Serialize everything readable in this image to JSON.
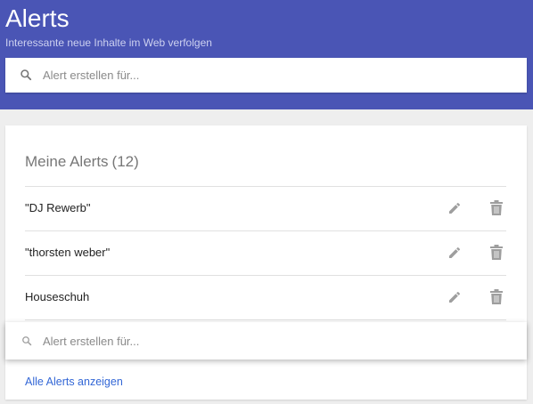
{
  "header": {
    "title": "Alerts",
    "subtitle": "Interessante neue Inhalte im Web verfolgen",
    "background_color": "#4a55b5"
  },
  "search": {
    "placeholder": "Alert erstellen für...",
    "icon": "search-icon"
  },
  "my_alerts": {
    "title": "Meine Alerts",
    "count": "(12)",
    "items": [
      {
        "label": "\"DJ Rewerb\"",
        "actions": [
          "pencil-icon",
          "trash-icon"
        ]
      },
      {
        "label": "\"thorsten weber\"",
        "actions": [
          "pencil-icon",
          "trash-icon"
        ]
      },
      {
        "label": "Houseschuh",
        "actions": [
          "pencil-icon",
          "trash-icon"
        ]
      }
    ]
  },
  "inline_search": {
    "placeholder": "Alert erstellen für...",
    "icon": "search-icon"
  },
  "footer": {
    "show_all_label": "Alle Alerts anzeigen",
    "link_color": "#3367d6"
  }
}
